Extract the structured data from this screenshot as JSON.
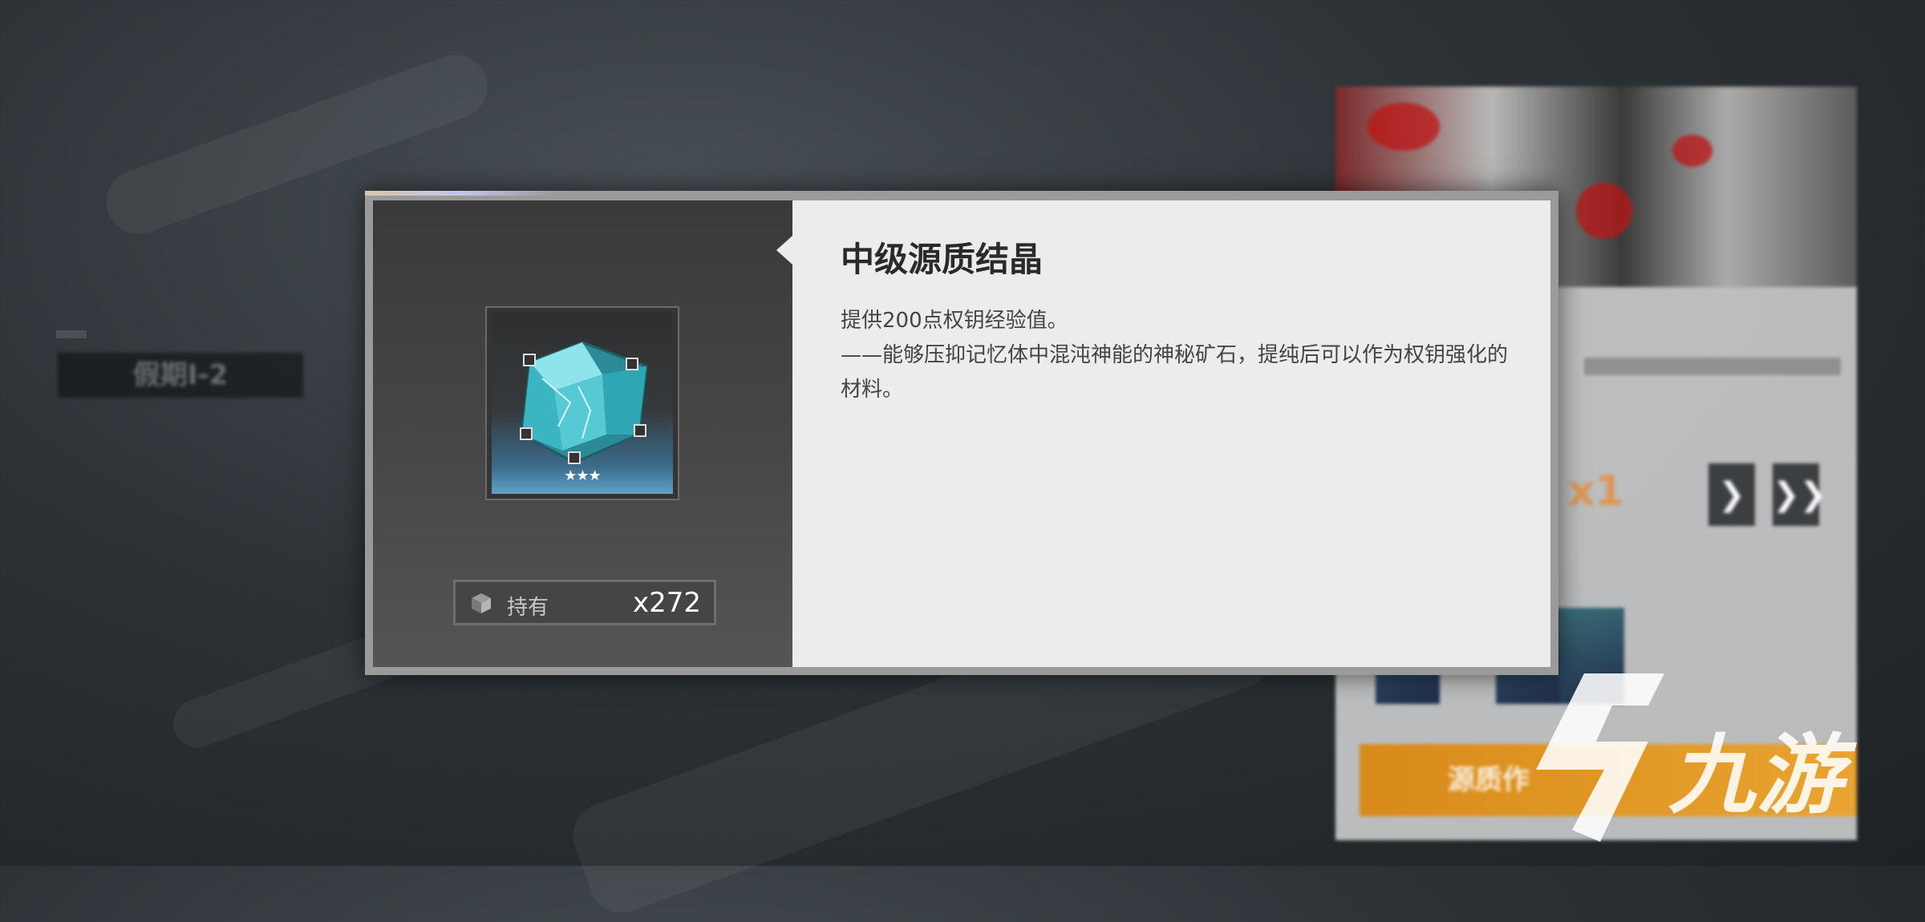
{
  "background": {
    "left_card_text": "假期I-2",
    "right_panel_orange_text": "x1",
    "right_panel_buttons": [
      "❯",
      "❯❯"
    ],
    "right_panel_yellow_text": "源质作"
  },
  "item_dialog": {
    "title": "中级源质结晶",
    "description_line1": "提供200点权钥经验值。",
    "description_line2": "——能够压抑记忆体中混沌神能的神秘矿石，提纯后可以作为权钥强化的材料。",
    "rarity_stars": "★★★",
    "hold_label": "持有",
    "hold_count": "x272",
    "icons": {
      "item": "crystal-cube-icon",
      "hold": "box-icon"
    },
    "colors": {
      "crystal": "#4fc4cf",
      "accent": "#c2c5e8"
    }
  },
  "watermark": {
    "logo_text": "九游"
  }
}
